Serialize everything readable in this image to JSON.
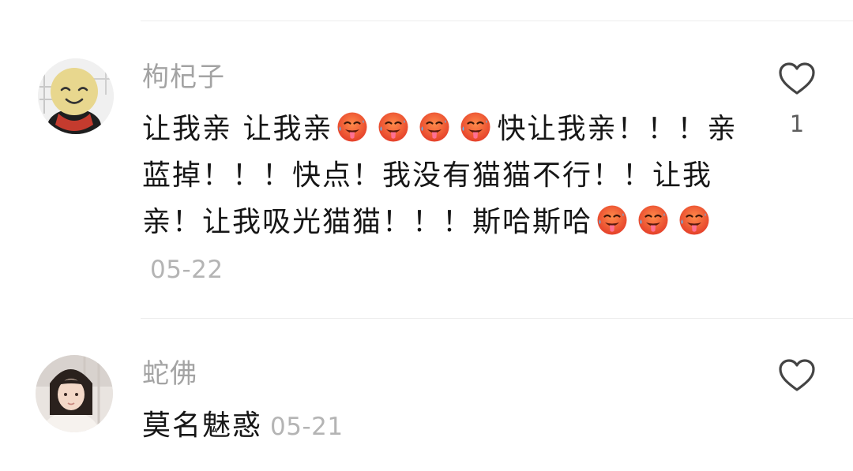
{
  "comments": [
    {
      "username": "枸杞子",
      "text_segments": [
        "让我亲 让我亲",
        "快让我亲！！！亲蓝掉！！！快点！我没有猫猫不行！！让我亲！让我吸光猫猫！！！斯哈斯哈"
      ],
      "date": "05-22",
      "likes": "1",
      "emoji": "hot-face-emoji"
    },
    {
      "username": "蛇佛",
      "text": "莫名魅惑",
      "date": "05-21",
      "likes": ""
    }
  ],
  "icons": {
    "like": "heart-outline-icon"
  },
  "colors": {
    "username": "#a3a3a3",
    "body_text": "#161616",
    "date": "#b4b4b4",
    "divider": "#ececec",
    "emoji_face": "#f26a3a"
  }
}
